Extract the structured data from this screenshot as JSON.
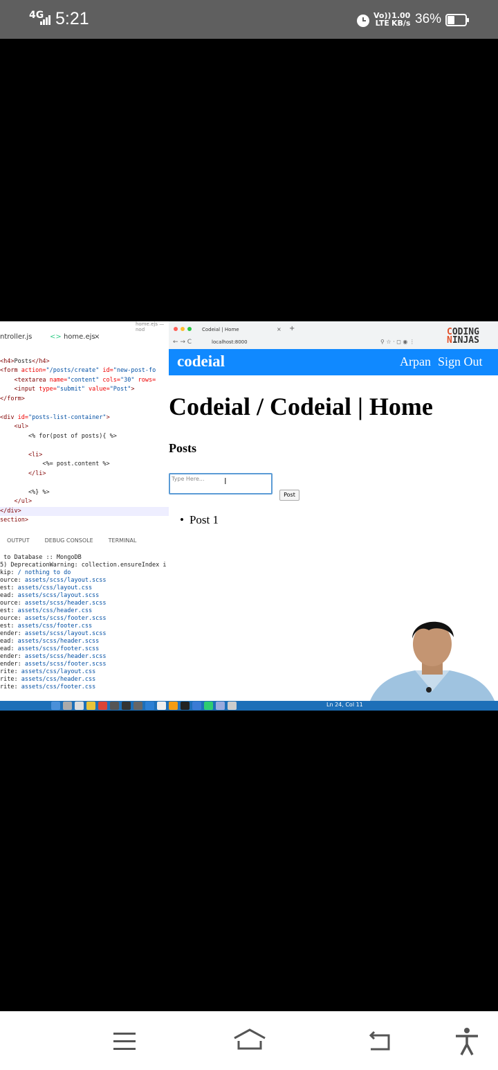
{
  "status_bar": {
    "network": "4G",
    "time": "5:21",
    "volte_top": "Vo))",
    "volte_bottom": "LTE",
    "speed_value": "1.00",
    "speed_unit": "KB/s",
    "battery": "36%"
  },
  "editor": {
    "tab_controller": "ntroller.js",
    "tab_home": "home.ejs",
    "tab_close": "×",
    "tab_icon": "<>",
    "crumb": "home.ejs — nod",
    "panel_tabs": [
      "OUTPUT",
      "DEBUG CONSOLE",
      "TERMINAL"
    ],
    "code_lines": [
      {
        "tag": "<h4>",
        "text": "Posts",
        "end": "</h4>"
      },
      {
        "raw_tag": "<form",
        "attr": " action=",
        "str": "\"/posts/create\"",
        "attr2": " id=",
        "str2": "\"new-post-fo"
      },
      {
        "raw_tag": "    <textarea",
        "attr": " name=",
        "str": "\"content\"",
        "attr2": " cols=",
        "str2": "\"30\"",
        "attr3": " rows="
      },
      {
        "raw_tag": "    <input",
        "attr": " type=",
        "str": "\"submit\"",
        "attr2": " value=",
        "str2": "\"Post\"",
        "close": ">"
      },
      {
        "raw_tag": "</form>"
      },
      {
        "raw_tag": ""
      },
      {
        "raw_tag": "<div",
        "attr": " id=",
        "str": "\"posts-list-container\"",
        "close": ">"
      },
      {
        "raw_tag": "    <ul>"
      },
      {
        "raw_tag": "        <% for(post of posts){ %>"
      },
      {
        "raw_tag": ""
      },
      {
        "raw_tag": "        <li>"
      },
      {
        "raw_tag": "            <%= post.content %>"
      },
      {
        "raw_tag": "        </li>"
      },
      {
        "raw_tag": ""
      },
      {
        "raw_tag": "        <%} %>"
      },
      {
        "raw_tag": "    </ul>"
      },
      {
        "raw_tag": "</div>"
      },
      {
        "raw_tag": "section>"
      }
    ],
    "terminal_lines": [
      {
        "pre": " to Database :: MongoDB",
        "link": ""
      },
      {
        "pre": "5) DeprecationWarning: collection.ensureIndex i",
        "link": ""
      },
      {
        "pre": "kip: ",
        "link": "/ nothing to do"
      },
      {
        "pre": "ource: ",
        "link": "assets/scss/layout.scss"
      },
      {
        "pre": "est: ",
        "link": "assets/css/layout.css"
      },
      {
        "pre": "ead: ",
        "link": "assets/scss/layout.scss"
      },
      {
        "pre": "ource: ",
        "link": "assets/scss/header.scss"
      },
      {
        "pre": "est: ",
        "link": "assets/css/header.css"
      },
      {
        "pre": "ource: ",
        "link": "assets/scss/footer.scss"
      },
      {
        "pre": "est: ",
        "link": "assets/css/footer.css"
      },
      {
        "pre": "ender: ",
        "link": "assets/scss/layout.scss"
      },
      {
        "pre": "ead: ",
        "link": "assets/scss/header.scss"
      },
      {
        "pre": "ead: ",
        "link": "assets/scss/footer.scss"
      },
      {
        "pre": "ender: ",
        "link": "assets/scss/header.scss"
      },
      {
        "pre": "ender: ",
        "link": "assets/scss/footer.scss"
      },
      {
        "pre": "rite: ",
        "link": "assets/css/layout.css"
      },
      {
        "pre": "rite: ",
        "link": "assets/css/header.css"
      },
      {
        "pre": "rite: ",
        "link": "assets/css/footer.css"
      }
    ],
    "cursor_position": "Ln 24, Col 11"
  },
  "browser": {
    "tab_title": "Codeial | Home",
    "tab_close": "×",
    "new_tab": "+",
    "url": "localhost:8000",
    "nav_icons": "←  →  C",
    "tools": "⚲  ☆  ·  ◻  ◉  ⋮"
  },
  "brand": {
    "line1": "ODING",
    "line2": "INJAS",
    "cap1": "C",
    "cap2": "N"
  },
  "site": {
    "logo": "codeial",
    "user_name": "Arpan",
    "sign_out": "Sign Out",
    "page_title": "Codeial / Codeial | Home",
    "posts_heading": "Posts",
    "textarea_placeholder": "Type Here...",
    "post_button": "Post",
    "posts": [
      "Post 1"
    ]
  },
  "colors": {
    "header_blue": "#1089ff",
    "taskbar_blue": "#1d6fb8",
    "status_bar_gray": "#5f5f5f"
  }
}
